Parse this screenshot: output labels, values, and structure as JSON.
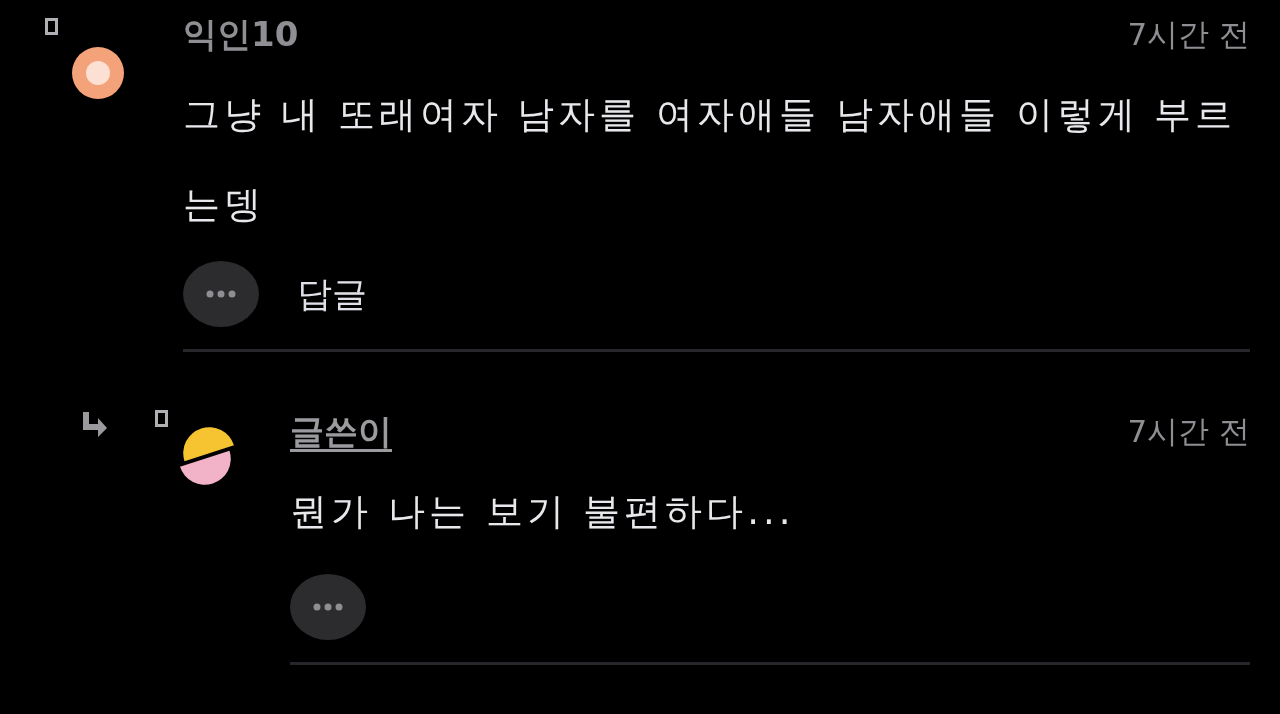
{
  "comments": [
    {
      "author": "익인10",
      "is_author": false,
      "time": "7시간 전",
      "text": "그냥 내 또래여자 남자를 여자애들 남자애들 이렇게 부르는뎅",
      "reply_label": "답글",
      "children": [
        {
          "author": "글쓴이",
          "is_author": true,
          "time": "7시간 전",
          "text": "뭔가 나는 보기 불편하다..."
        }
      ]
    }
  ]
}
